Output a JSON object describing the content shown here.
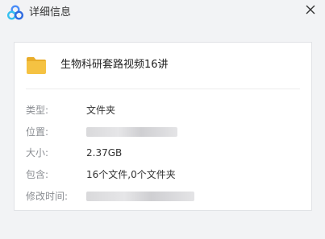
{
  "window": {
    "title": "详细信息",
    "close_label": "×"
  },
  "file": {
    "name": "生物科研套路视频16讲",
    "icon": "folder-icon"
  },
  "details": [
    {
      "label": "类型:",
      "value": "文件夹"
    },
    {
      "label": "位置:",
      "value": ""
    },
    {
      "label": "大小:",
      "value": "2.37GB"
    },
    {
      "label": "包含:",
      "value": "16个文件,0个文件夹"
    },
    {
      "label": "修改时间:",
      "value": ""
    }
  ],
  "colors": {
    "folder": "#f5c242",
    "folder_tab": "#e9ad2a",
    "logo_blue": "#4a8df8"
  }
}
